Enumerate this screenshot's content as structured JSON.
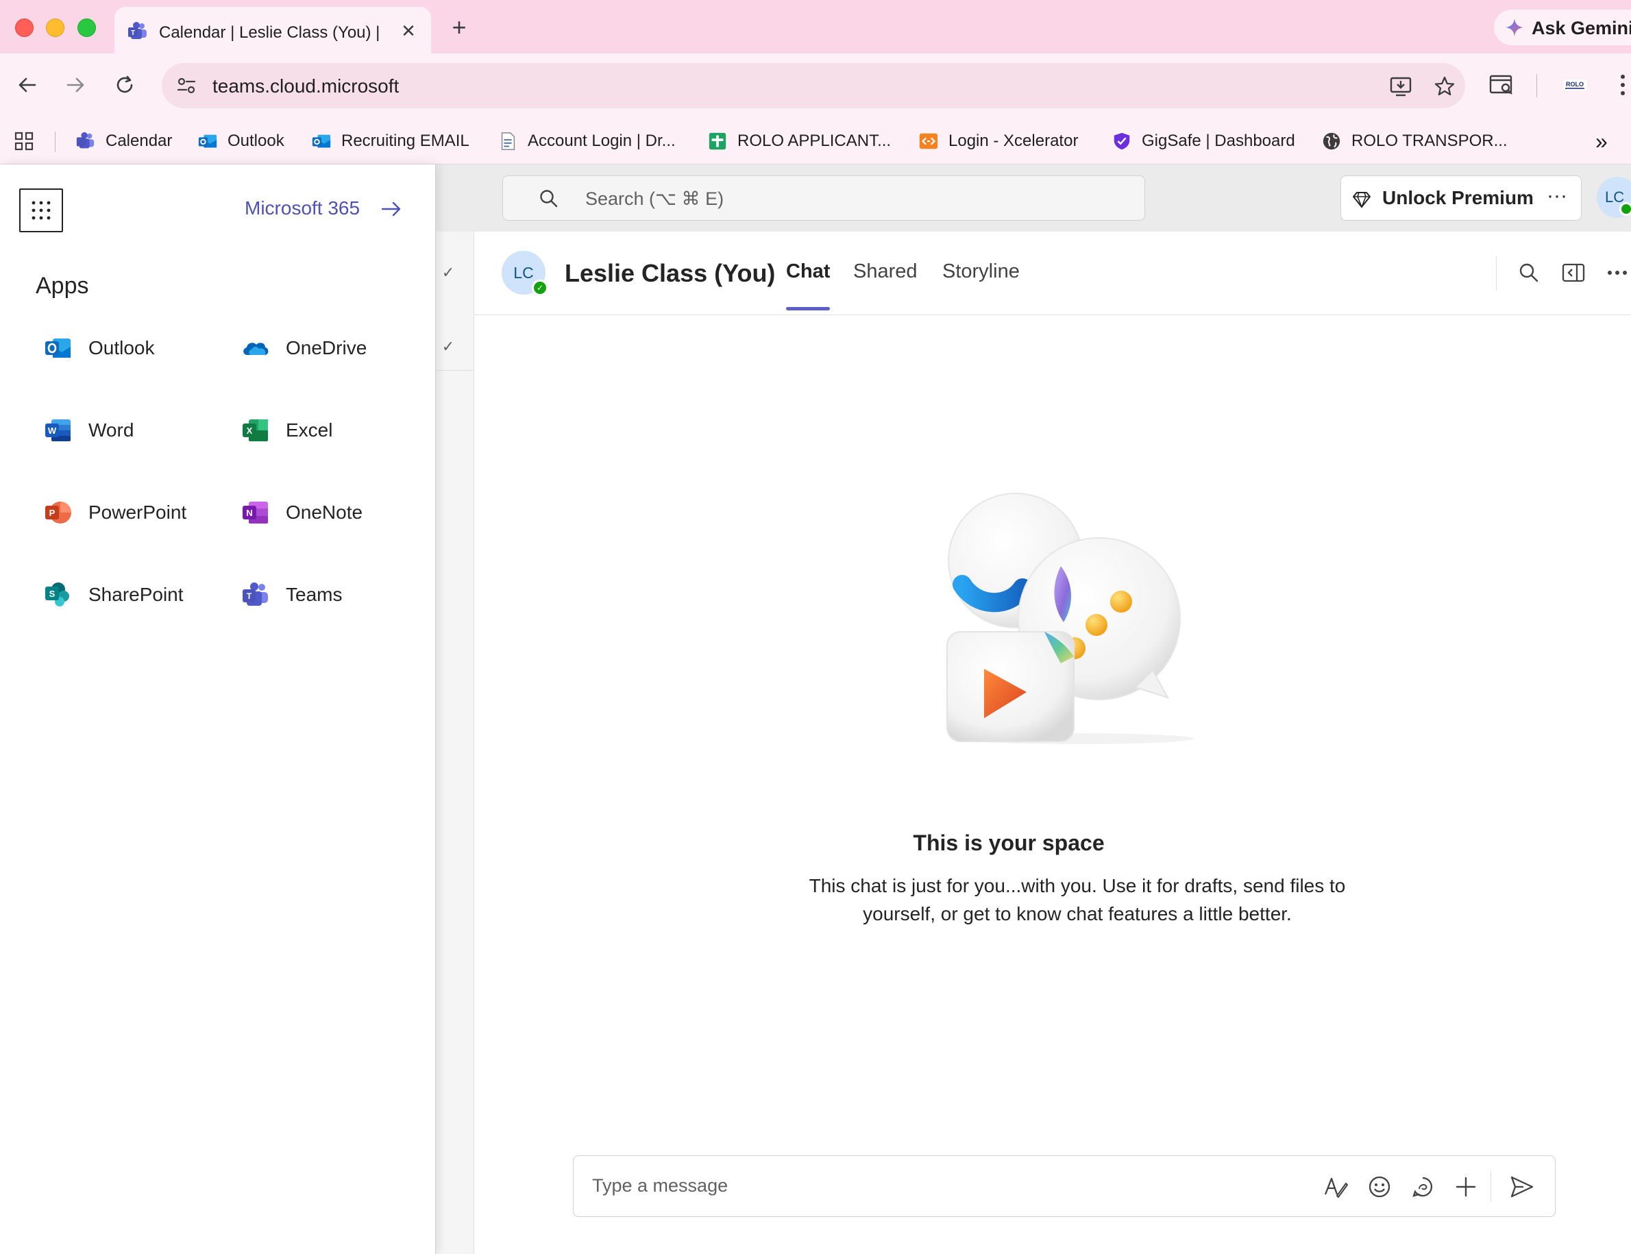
{
  "browser": {
    "tab": {
      "title": "Calendar | Leslie Class (You) |",
      "close": "✕"
    },
    "new_tab": "+",
    "gemini_label": "Ask Gemini",
    "url": "teams.cloud.microsoft",
    "bookmarks": [
      {
        "label": "Calendar",
        "icon": "teams-icon"
      },
      {
        "label": "Outlook",
        "icon": "outlook-icon"
      },
      {
        "label": "Recruiting EMAIL",
        "icon": "outlook-icon"
      },
      {
        "label": "Account Login | Dr...",
        "icon": "document-icon"
      },
      {
        "label": "ROLO APPLICANT...",
        "icon": "sheets-icon"
      },
      {
        "label": "Login - Xcelerator",
        "icon": "code-icon"
      },
      {
        "label": "GigSafe | Dashboard",
        "icon": "shield-icon"
      },
      {
        "label": "ROLO TRANSPOR...",
        "icon": "globe-icon"
      }
    ],
    "more_bookmarks": "»"
  },
  "teams": {
    "search_placeholder": "Search (⌥ ⌘ E)",
    "premium_label": "Unlock Premium",
    "premium_more": "···",
    "user_initials": "LC",
    "chat": {
      "avatar_initials": "LC",
      "name": "Leslie Class (You)",
      "tabs": [
        "Chat",
        "Shared",
        "Storyline"
      ],
      "active_tab": "Chat",
      "empty_title": "This is your space",
      "empty_body": "This chat is just for you...with you. Use it for drafts, send files to yourself, or get to know chat features a little better.",
      "composer_placeholder": "Type a message"
    }
  },
  "launcher": {
    "m365_link": "Microsoft 365",
    "apps_heading": "Apps",
    "apps": [
      {
        "label": "Outlook",
        "icon": "outlook-icon",
        "color": "#0f6cbd"
      },
      {
        "label": "OneDrive",
        "icon": "onedrive-icon",
        "color": "#0364b8"
      },
      {
        "label": "Word",
        "icon": "word-icon",
        "color": "#185abd"
      },
      {
        "label": "Excel",
        "icon": "excel-icon",
        "color": "#107c41"
      },
      {
        "label": "PowerPoint",
        "icon": "powerpoint-icon",
        "color": "#c43e1c"
      },
      {
        "label": "OneNote",
        "icon": "onenote-icon",
        "color": "#7719aa"
      },
      {
        "label": "SharePoint",
        "icon": "sharepoint-icon",
        "color": "#038387"
      },
      {
        "label": "Teams",
        "icon": "teams-icon",
        "color": "#5b5fc7"
      }
    ]
  },
  "colors": {
    "tabstrip": "#fbd6e7",
    "toolbar": "#fdf0f6",
    "teams_accent": "#5b5fc7",
    "m365_link": "#4f52b2",
    "presence_available": "#13a10e"
  }
}
